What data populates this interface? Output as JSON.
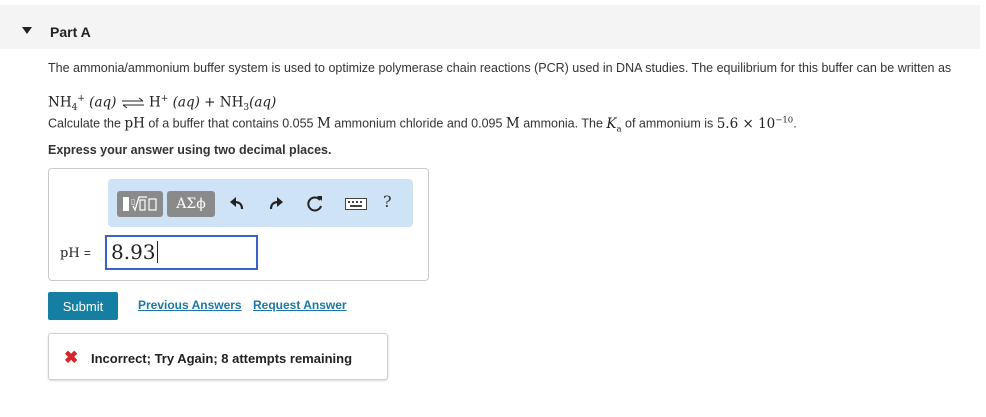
{
  "part": {
    "title": "Part A"
  },
  "problem": {
    "intro": "The ammonia/ammonium buffer system is used to optimize polymerase chain reactions (PCR) used in DNA studies. The equilibrium for this buffer can be written as",
    "equation": {
      "reactant": "NH",
      "reactant_sub": "4",
      "reactant_charge": "+",
      "reactant_state": "(aq)",
      "product1": "H",
      "product1_charge": "+",
      "product1_state": "(aq)",
      "plus": "+",
      "product2": "NH",
      "product2_sub": "3",
      "product2_state": "(aq)"
    },
    "question": {
      "part1": "Calculate the ",
      "ph_symbol": "pH",
      "part2": " of a buffer that contains 0.055 ",
      "molar1": "M",
      "part3": " ammonium chloride and 0.095 ",
      "molar2": "M",
      "part4": " ammonia. The ",
      "ka_symbol": "K",
      "ka_sub": "a",
      "part5": " of ammonium is ",
      "ka_value": "5.6 × 10",
      "ka_exp": "−10",
      "period": "."
    },
    "instruction": "Express your answer using two decimal places."
  },
  "toolbar": {
    "greek_label": "ΑΣϕ",
    "help_label": "?",
    "icons": [
      "template-icon",
      "undo-icon",
      "redo-icon",
      "reset-icon",
      "keyboard-icon",
      "help-icon"
    ]
  },
  "answer": {
    "label": "pH",
    "equals": "=",
    "value": "8.93"
  },
  "actions": {
    "submit_label": "Submit",
    "previous_answers_label": "Previous Answers",
    "request_answer_label": "Request Answer"
  },
  "feedback": {
    "icon": "✖",
    "message": "Incorrect; Try Again; 8 attempts remaining",
    "color": "#d9222a"
  },
  "colors": {
    "accent": "#157ea3",
    "toolbar_bg": "#cfe3f7",
    "input_border": "#3a62c9",
    "link": "#1a78a8"
  }
}
